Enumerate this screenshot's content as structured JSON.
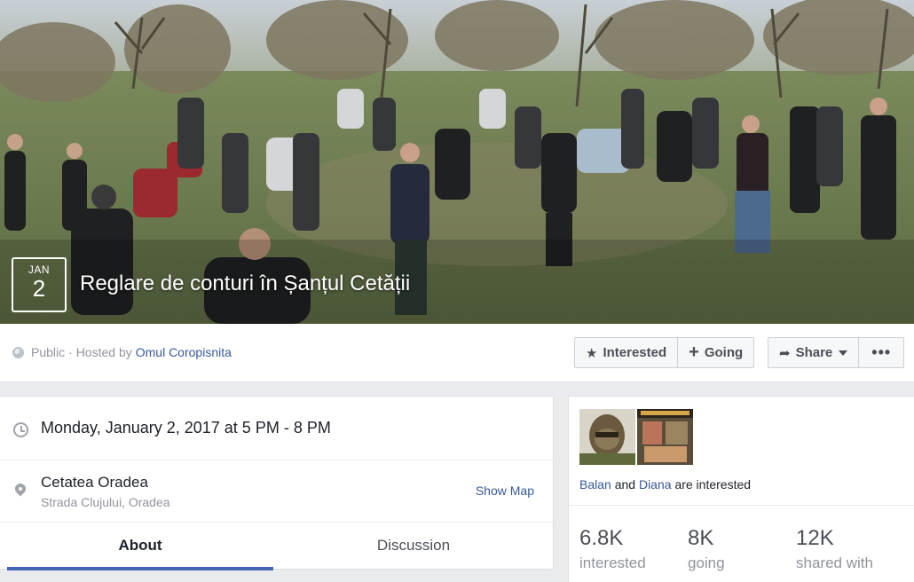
{
  "event": {
    "date_month": "JAN",
    "date_day": "2",
    "title": "Reglare de conturi în Șanțul Cetății"
  },
  "infobar": {
    "privacy": "Public",
    "hosted_by_prefix": "· Hosted by",
    "host_name": "Omul Coropisnita",
    "interested_label": "Interested",
    "going_label": "Going",
    "share_label": "Share",
    "more_label": "•••"
  },
  "details": {
    "datetime": "Monday, January 2, 2017 at 5 PM - 8 PM",
    "place_name": "Cetatea Oradea",
    "place_address": "Strada Clujului, Oradea",
    "show_map": "Show Map"
  },
  "tabs": [
    {
      "label": "About",
      "active": true
    },
    {
      "label": "Discussion",
      "active": false
    }
  ],
  "friends": {
    "name1": "Balan",
    "connector": "and",
    "name2": "Diana",
    "suffix": "are interested"
  },
  "stats": [
    {
      "value": "6.8K",
      "label": "interested"
    },
    {
      "value": "8K",
      "label": "going"
    },
    {
      "value": "12K",
      "label": "shared with"
    }
  ],
  "colors": {
    "link": "#365899",
    "accent": "#4267b2",
    "background": "#e9ebee"
  }
}
